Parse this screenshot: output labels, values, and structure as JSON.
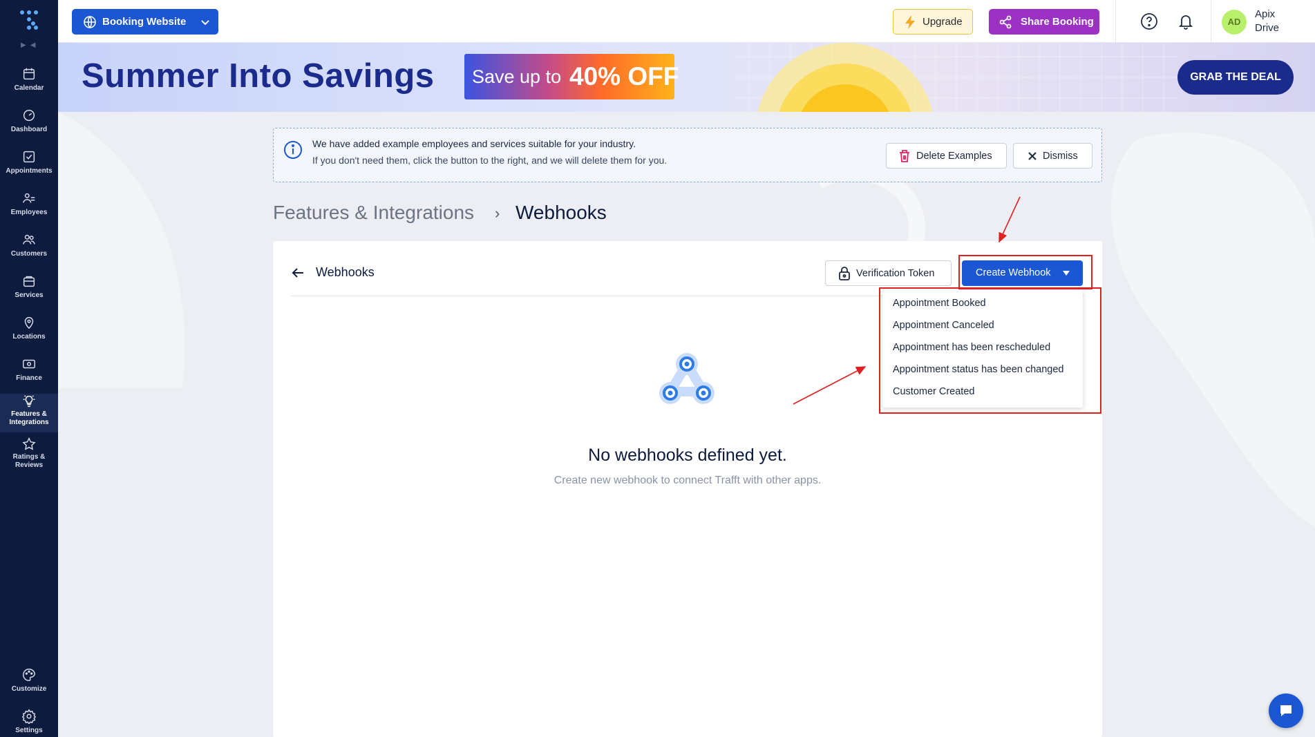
{
  "sidebar": {
    "items": [
      {
        "label": "Calendar",
        "icon": "calendar-icon"
      },
      {
        "label": "Dashboard",
        "icon": "dashboard-icon"
      },
      {
        "label": "Appointments",
        "icon": "appointments-icon"
      },
      {
        "label": "Employees",
        "icon": "employees-icon"
      },
      {
        "label": "Customers",
        "icon": "customers-icon"
      },
      {
        "label": "Services",
        "icon": "services-icon"
      },
      {
        "label": "Locations",
        "icon": "location-pin-icon"
      },
      {
        "label": "Finance",
        "icon": "finance-icon"
      },
      {
        "label": "Features &\nIntegrations",
        "icon": "lightbulb-icon",
        "active": true
      },
      {
        "label": "Ratings &\nReviews",
        "icon": "star-icon"
      }
    ],
    "bottom_items": [
      {
        "label": "Customize",
        "icon": "palette-icon"
      },
      {
        "label": "Settings",
        "icon": "gear-icon"
      }
    ]
  },
  "topbar": {
    "booking_selector": "Booking Website",
    "upgrade_label": "Upgrade",
    "share_label": "Share Booking",
    "avatar_initials": "AD",
    "user_name": "Apix Drive"
  },
  "promo": {
    "title": "Summer Into Savings",
    "badge_prefix": "Save up to",
    "badge_value": "40% OFF",
    "cta": "GRAB THE DEAL"
  },
  "notice": {
    "line1": "We have added example employees and services suitable for your industry.",
    "line2": "If you don't need them, click the button to the right, and we will delete them for you.",
    "delete_label": "Delete Examples",
    "dismiss_label": "Dismiss"
  },
  "breadcrumb": {
    "parent": "Features & Integrations",
    "separator": "›",
    "current": "Webhooks"
  },
  "card": {
    "title": "Webhooks",
    "verification_label": "Verification Token",
    "create_label": "Create Webhook",
    "empty_title": "No webhooks defined yet.",
    "empty_subtitle": "Create new webhook to connect Trafft with other apps."
  },
  "dropdown": {
    "items": [
      "Appointment Booked",
      "Appointment Canceled",
      "Appointment has been rescheduled",
      "Appointment status has been changed",
      "Customer Created"
    ]
  },
  "colors": {
    "sidebar_bg": "#0d1b3e",
    "primary": "#1b57d2",
    "share": "#9b32c4",
    "promo_title": "#1b2b8c",
    "highlight": "#e02020"
  }
}
